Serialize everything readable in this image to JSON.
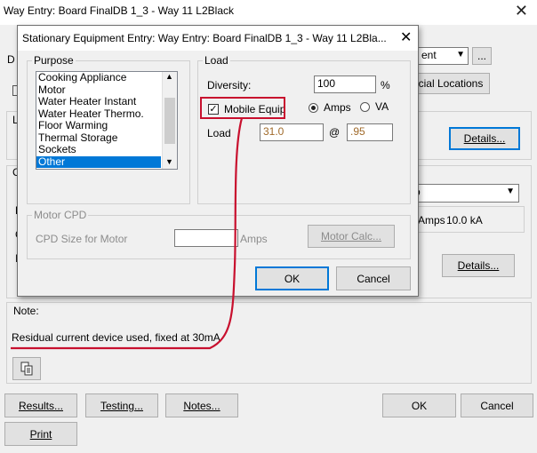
{
  "main_window": {
    "title": "Way Entry: Board FinalDB 1_3 - Way 11 L2Black",
    "close_glyph": "✕",
    "frag_right_dropdown": "ent",
    "frag_ellipsis": "...",
    "frag_special_locations": "cial Locations",
    "details_top": "Details...",
    "frag_combo2": "o",
    "frag_amps": "Amps",
    "frag_ka": "10.0 kA",
    "details_mid": "Details...",
    "frag_l1": "L",
    "frag_d": "D",
    "frag_c": "C",
    "frag_l2": "L",
    "frag_c2": "C",
    "frag_i": "I",
    "note_label": "Note:",
    "note_text": "Residual current device used, fixed at 30mA",
    "buttons": {
      "results": "Results...",
      "testing": "Testing...",
      "notes": "Notes...",
      "ok": "OK",
      "cancel": "Cancel",
      "print": "Print"
    }
  },
  "dialog": {
    "title": "Stationary Equipment Entry:  Way Entry: Board FinalDB 1_3 - Way 11 L2Bla...",
    "close_glyph": "✕",
    "purpose": {
      "label": "Purpose",
      "items": [
        "Cooking Appliance",
        "Motor",
        "Water Heater Instant",
        "Water Heater Thermo.",
        "Floor Warming",
        "Thermal Storage",
        "Sockets",
        "Other"
      ],
      "selected": "Other"
    },
    "load": {
      "label": "Load",
      "diversity_label": "Diversity:",
      "diversity_value": "100",
      "diversity_unit": "%",
      "mobile_equip_label": "Mobile Equip",
      "mobile_equip_checked": true,
      "amps_label": "Amps",
      "va_label": "VA",
      "unit_selected": "Amps",
      "load_label": "Load",
      "load_value": "31.0",
      "at_symbol": "@",
      "pf_value": ".95"
    },
    "motor_cpd": {
      "label": "Motor CPD",
      "cpd_size_label": "CPD Size for Motor",
      "cpd_size_value": "",
      "amps_unit": "Amps",
      "motor_calc_button": "Motor Calc..."
    },
    "ok": "OK",
    "cancel": "Cancel"
  },
  "colors": {
    "annotation_red": "#c8102e",
    "selection_blue": "#0078d7"
  }
}
